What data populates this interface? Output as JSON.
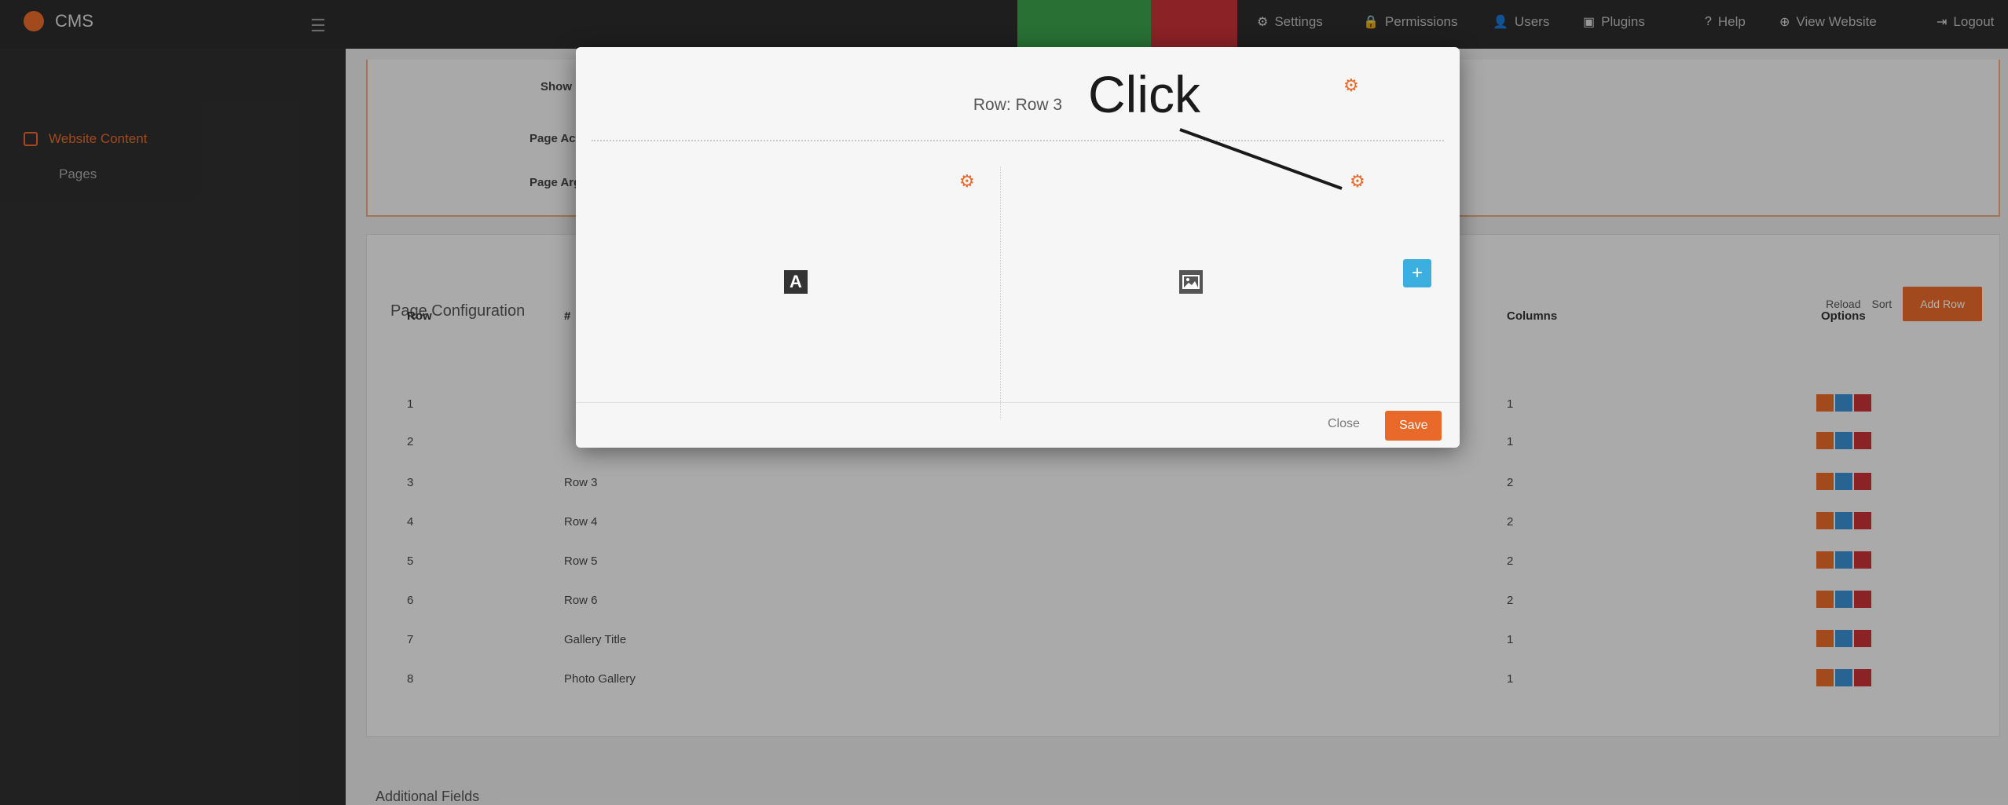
{
  "topbar": {
    "brand": "CMS",
    "green_btn": "",
    "red_btn": "",
    "links": [
      {
        "icon": "gear-icon",
        "label": "Settings",
        "glyph": "⚙"
      },
      {
        "icon": "lock-icon",
        "label": "Permissions",
        "glyph": "🔒"
      },
      {
        "icon": "user-icon",
        "label": "Users",
        "glyph": "👤"
      },
      {
        "icon": "plugin-icon",
        "label": "Plugins",
        "glyph": "▣"
      },
      {
        "icon": "help-icon",
        "label": "Help",
        "glyph": "?"
      },
      {
        "icon": "globe-icon",
        "label": "View Website",
        "glyph": "⊕"
      },
      {
        "icon": "logout-icon",
        "label": "Logout",
        "glyph": "⇥"
      }
    ]
  },
  "sidebar": {
    "active_item": "Website Content",
    "sub_item": "Pages"
  },
  "page_info": {
    "labels": [
      "Show in",
      "Page Acti",
      "Page Argu"
    ]
  },
  "page_config": {
    "title": "Page Configuration",
    "reload": "Reload",
    "sort": "Sort",
    "add_row": "Add Row",
    "columns": [
      "Row",
      "#",
      "Columns",
      "Options"
    ],
    "rows": [
      {
        "row": "1",
        "name": "",
        "columns": "1"
      },
      {
        "row": "2",
        "name": "",
        "columns": "1"
      },
      {
        "row": "3",
        "name": "Row 3",
        "columns": "2"
      },
      {
        "row": "4",
        "name": "Row 4",
        "columns": "2"
      },
      {
        "row": "5",
        "name": "Row 5",
        "columns": "2"
      },
      {
        "row": "6",
        "name": "Row 6",
        "columns": "2"
      },
      {
        "row": "7",
        "name": "Gallery Title",
        "columns": "1"
      },
      {
        "row": "8",
        "name": "Photo Gallery",
        "columns": "1"
      }
    ]
  },
  "additional_fields": "Additional Fields",
  "modal": {
    "title": "Row: Row 3",
    "close_label": "Close",
    "save_label": "Save",
    "col1_icon": "A",
    "add_glyph": "+"
  },
  "annotation": {
    "text": "Click"
  },
  "colors": {
    "accent": "#e8692a",
    "info_blue": "#3bb0e0"
  }
}
